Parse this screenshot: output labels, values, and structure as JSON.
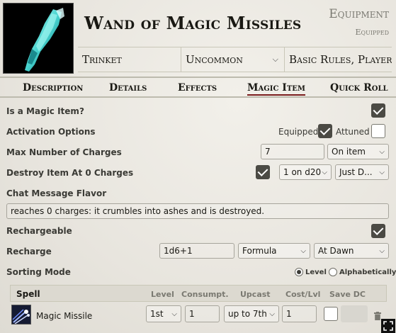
{
  "item": {
    "name": "Wand of Magic Missiles",
    "type": "Equipment",
    "status": "Equipped",
    "subtype": "Trinket",
    "rarity": "Uncommon",
    "source": "Basic Rules, Player's Ha"
  },
  "tabs": [
    {
      "label": "Description",
      "active": false
    },
    {
      "label": "Details",
      "active": false
    },
    {
      "label": "Effects",
      "active": false
    },
    {
      "label": "Magic Item",
      "active": true
    },
    {
      "label": "Quick Roll",
      "active": false
    }
  ],
  "form": {
    "is_magic_label": "Is a Magic Item?",
    "is_magic": true,
    "activation_label": "Activation Options",
    "equipped_label": "Equipped",
    "equipped": true,
    "attuned_label": "Attuned",
    "attuned": false,
    "max_charges_label": "Max Number of Charges",
    "max_charges": "7",
    "charges_type": "On item",
    "destroy_label": "Destroy Item At 0 Charges",
    "destroy": true,
    "destroy_roll": "1 on d20",
    "destroy_type": "Just D...",
    "chat_flavor_label": "Chat Message Flavor",
    "chat_flavor": "reaches 0 charges: it crumbles into ashes and is destroyed.",
    "rechargeable_label": "Rechargeable",
    "rechargeable": true,
    "recharge_label": "Recharge",
    "recharge_formula": "1d6+1",
    "recharge_type": "Formula",
    "recharge_time": "At Dawn",
    "sorting_label": "Sorting Mode",
    "sort_level_label": "Level",
    "sort_alpha_label": "Alphabetically",
    "sort_mode": "level"
  },
  "spell_table": {
    "headers": {
      "spell": "Spell",
      "level": "Level",
      "consumpt": "Consumpt.",
      "upcast": "Upcast",
      "cost": "Cost/Lvl",
      "save_dc": "Save DC"
    },
    "rows": [
      {
        "name": "Magic Missile",
        "level": "1st",
        "consumption": "1",
        "upcast": "up to 7th",
        "cost": "1",
        "save_dc_override": false
      }
    ]
  },
  "icons": {
    "item_image": "crystal-wand-icon",
    "spell_image": "magic-missile-icon",
    "delete": "trash-icon",
    "expand": "expand-icon"
  },
  "colors": {
    "accent": "#7a1c1c",
    "checkbox_on": "#4b4a44",
    "text": "#191813",
    "muted": "#7a7971"
  }
}
